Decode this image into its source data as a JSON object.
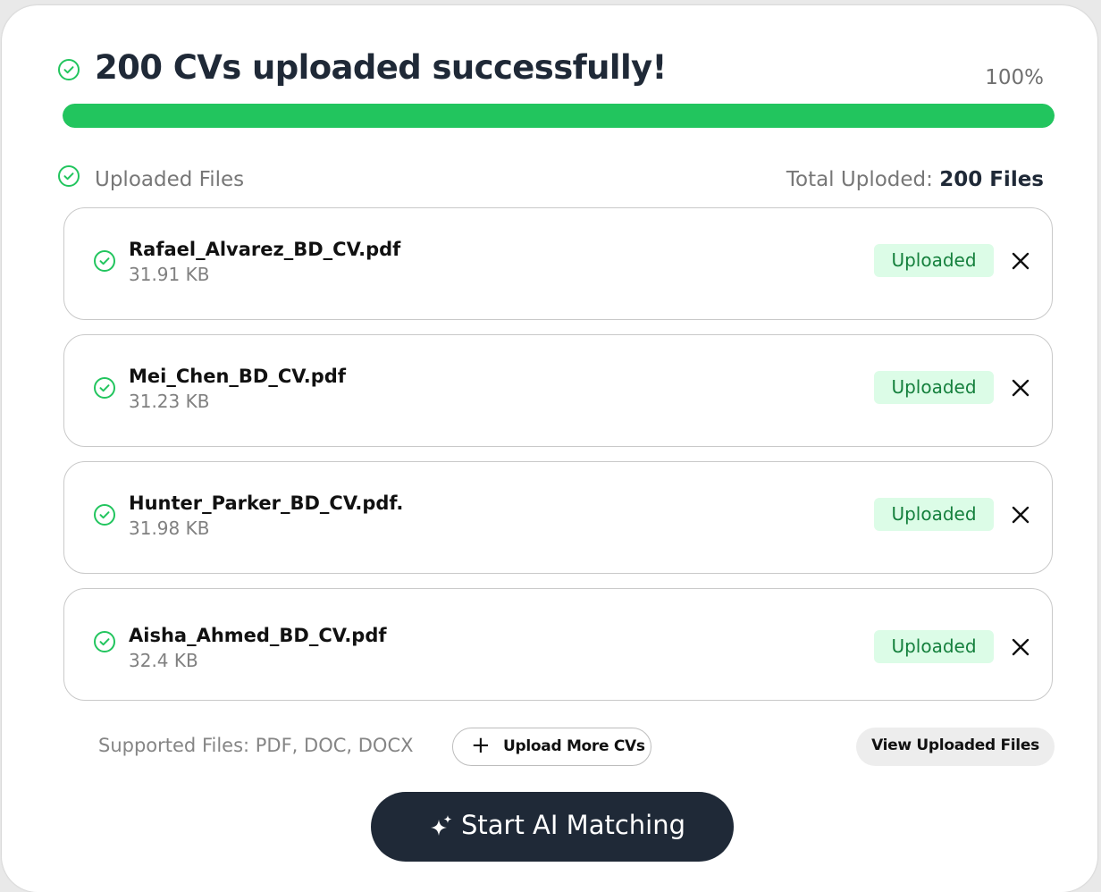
{
  "header": {
    "title": "200 CVs uploaded successfully!",
    "progress_label": "100%",
    "progress_value": 1.0
  },
  "section": {
    "label": "Uploaded Files",
    "total_prefix": "Total Uploded:",
    "total_value": "200 Files"
  },
  "files": [
    {
      "name": "Rafael_Alvarez_BD_CV.pdf",
      "size": "31.91 KB",
      "status": "Uploaded"
    },
    {
      "name": "Mei_Chen_BD_CV.pdf",
      "size": "31.23 KB",
      "status": "Uploaded"
    },
    {
      "name": "Hunter_Parker_BD_CV.pdf.",
      "size": "31.98 KB",
      "status": "Uploaded"
    },
    {
      "name": "Aisha_Ahmed_BD_CV.pdf",
      "size": "32.4 KB",
      "status": "Uploaded"
    }
  ],
  "footer": {
    "supported": "Supported Files: PDF, DOC, DOCX",
    "upload_more_icon": "+",
    "upload_more_label": "Upload More CVs",
    "view_uploaded_label": "View Uploaded Files",
    "start_label": "Start AI Matching"
  },
  "colors": {
    "accent_green": "#22c55e",
    "badge_bg": "#dcfce7",
    "badge_text": "#15803d",
    "dark": "#1f2937"
  },
  "icons": {
    "check": "check-circle-icon",
    "close": "close-icon",
    "plus": "plus-icon",
    "sparkle": "sparkle-icon"
  }
}
